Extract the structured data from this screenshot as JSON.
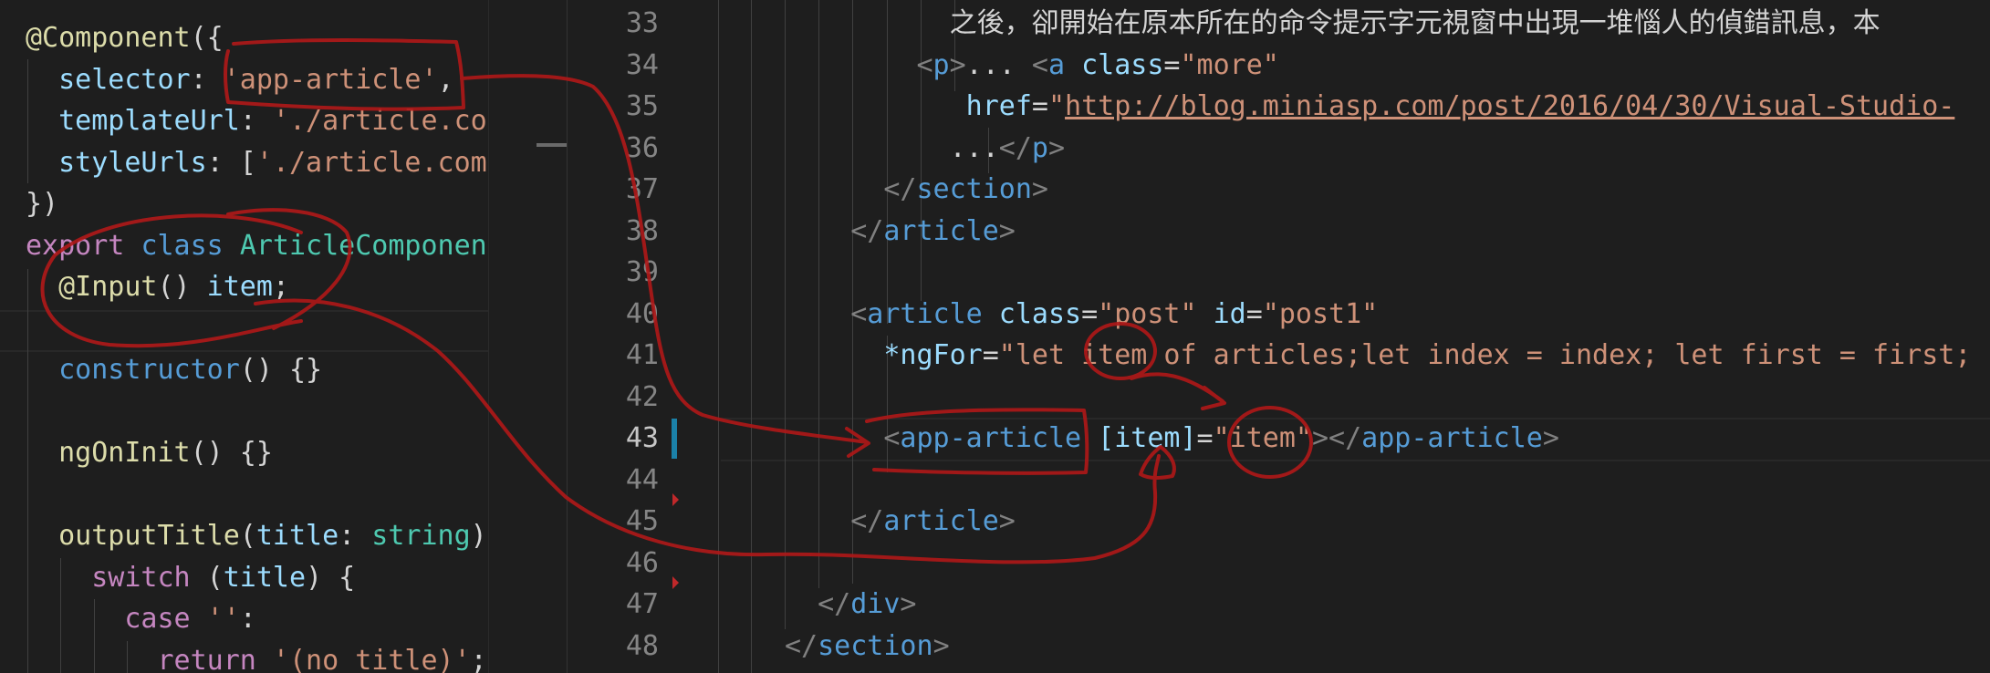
{
  "left_editor": {
    "lines": [
      {
        "indent": 0,
        "tokens": [
          {
            "t": "@Component",
            "c": "fn"
          },
          {
            "t": "({",
            "c": "txt"
          }
        ]
      },
      {
        "indent": 2,
        "tokens": [
          {
            "t": "selector",
            "c": "attr"
          },
          {
            "t": ": ",
            "c": "txt"
          },
          {
            "t": "'app-article'",
            "c": "str"
          },
          {
            "t": ",",
            "c": "txt"
          }
        ]
      },
      {
        "indent": 2,
        "tokens": [
          {
            "t": "templateUrl",
            "c": "attr"
          },
          {
            "t": ": ",
            "c": "txt"
          },
          {
            "t": "'./article.co",
            "c": "str"
          }
        ]
      },
      {
        "indent": 2,
        "tokens": [
          {
            "t": "styleUrls",
            "c": "attr"
          },
          {
            "t": ": [",
            "c": "txt"
          },
          {
            "t": "'./article.com",
            "c": "str"
          }
        ]
      },
      {
        "indent": 0,
        "tokens": [
          {
            "t": "})",
            "c": "txt"
          }
        ]
      },
      {
        "indent": 0,
        "tokens": [
          {
            "t": "export",
            "c": "kw"
          },
          {
            "t": " ",
            "c": "txt"
          },
          {
            "t": "class",
            "c": "key"
          },
          {
            "t": " ",
            "c": "txt"
          },
          {
            "t": "ArticleComponen",
            "c": "cls"
          }
        ]
      },
      {
        "indent": 2,
        "tokens": [
          {
            "t": "@Input",
            "c": "fn"
          },
          {
            "t": "() ",
            "c": "txt"
          },
          {
            "t": "item",
            "c": "attr"
          },
          {
            "t": ";",
            "c": "txt"
          }
        ]
      },
      {
        "indent": 0,
        "tokens": []
      },
      {
        "indent": 2,
        "tokens": [
          {
            "t": "constructor",
            "c": "key"
          },
          {
            "t": "() {}",
            "c": "txt"
          }
        ]
      },
      {
        "indent": 0,
        "tokens": []
      },
      {
        "indent": 2,
        "tokens": [
          {
            "t": "ngOnInit",
            "c": "fn"
          },
          {
            "t": "() {}",
            "c": "txt"
          }
        ]
      },
      {
        "indent": 0,
        "tokens": []
      },
      {
        "indent": 2,
        "tokens": [
          {
            "t": "outputTitle",
            "c": "fn"
          },
          {
            "t": "(",
            "c": "txt"
          },
          {
            "t": "title",
            "c": "attr"
          },
          {
            "t": ": ",
            "c": "txt"
          },
          {
            "t": "string",
            "c": "cls"
          },
          {
            "t": ")",
            "c": "txt"
          }
        ]
      },
      {
        "indent": 4,
        "tokens": [
          {
            "t": "switch",
            "c": "kw"
          },
          {
            "t": " (",
            "c": "txt"
          },
          {
            "t": "title",
            "c": "attr"
          },
          {
            "t": ") {",
            "c": "txt"
          }
        ]
      },
      {
        "indent": 6,
        "tokens": [
          {
            "t": "case",
            "c": "kw"
          },
          {
            "t": " ",
            "c": "txt"
          },
          {
            "t": "''",
            "c": "str"
          },
          {
            "t": ":",
            "c": "txt"
          }
        ]
      },
      {
        "indent": 8,
        "tokens": [
          {
            "t": "return",
            "c": "kw"
          },
          {
            "t": " ",
            "c": "txt"
          },
          {
            "t": "'(no title)'",
            "c": "str"
          },
          {
            "t": ";",
            "c": "txt"
          }
        ]
      }
    ]
  },
  "right_editor": {
    "current_line": 43,
    "lines": [
      {
        "num": "33",
        "indent": 10,
        "tokens": [
          {
            "t": "之後，卻開始在原本所在的命令提示字元視窗中出現一堆惱人的偵錯訊息，本",
            "c": "txt"
          }
        ]
      },
      {
        "num": "34",
        "indent": 8,
        "tokens": [
          {
            "t": "<",
            "c": "tag"
          },
          {
            "t": "p",
            "c": "tn"
          },
          {
            "t": ">",
            "c": "tag"
          },
          {
            "t": "... ",
            "c": "txt"
          },
          {
            "t": "<",
            "c": "tag"
          },
          {
            "t": "a",
            "c": "tn"
          },
          {
            "t": " ",
            "c": "txt"
          },
          {
            "t": "class",
            "c": "attr"
          },
          {
            "t": "=",
            "c": "txt"
          },
          {
            "t": "\"more\"",
            "c": "str"
          }
        ]
      },
      {
        "num": "35",
        "indent": 11,
        "tokens": [
          {
            "t": "href",
            "c": "attr"
          },
          {
            "t": "=",
            "c": "txt"
          },
          {
            "t": "\"",
            "c": "str"
          },
          {
            "t": "http://blog.miniasp.com/post/2016/04/30/Visual-Studio-",
            "c": "link"
          }
        ]
      },
      {
        "num": "36",
        "indent": 10,
        "tokens": [
          {
            "t": "...",
            "c": "txt"
          },
          {
            "t": "</",
            "c": "tag"
          },
          {
            "t": "p",
            "c": "tn"
          },
          {
            "t": ">",
            "c": "tag"
          }
        ]
      },
      {
        "num": "37",
        "indent": 6,
        "tokens": [
          {
            "t": "</",
            "c": "tag"
          },
          {
            "t": "section",
            "c": "tn"
          },
          {
            "t": ">",
            "c": "tag"
          }
        ]
      },
      {
        "num": "38",
        "indent": 4,
        "tokens": [
          {
            "t": "</",
            "c": "tag"
          },
          {
            "t": "article",
            "c": "tn"
          },
          {
            "t": ">",
            "c": "tag"
          }
        ]
      },
      {
        "num": "39",
        "indent": 0,
        "tokens": []
      },
      {
        "num": "40",
        "indent": 4,
        "tokens": [
          {
            "t": "<",
            "c": "tag"
          },
          {
            "t": "article",
            "c": "tn"
          },
          {
            "t": " ",
            "c": "txt"
          },
          {
            "t": "class",
            "c": "attr"
          },
          {
            "t": "=",
            "c": "txt"
          },
          {
            "t": "\"post\"",
            "c": "str"
          },
          {
            "t": " ",
            "c": "txt"
          },
          {
            "t": "id",
            "c": "attr"
          },
          {
            "t": "=",
            "c": "txt"
          },
          {
            "t": "\"post1\"",
            "c": "str"
          }
        ]
      },
      {
        "num": "41",
        "indent": 6,
        "tokens": [
          {
            "t": "*ngFor",
            "c": "attr"
          },
          {
            "t": "=",
            "c": "txt"
          },
          {
            "t": "\"let item of articles;let index = index; let first = first;",
            "c": "str"
          }
        ]
      },
      {
        "num": "42",
        "indent": 0,
        "tokens": []
      },
      {
        "num": "43",
        "indent": 6,
        "tokens": [
          {
            "t": "<",
            "c": "tag"
          },
          {
            "t": "app-article",
            "c": "tn"
          },
          {
            "t": " ",
            "c": "txt"
          },
          {
            "t": "[item]",
            "c": "attr"
          },
          {
            "t": "=",
            "c": "txt"
          },
          {
            "t": "\"item\"",
            "c": "str"
          },
          {
            "t": ">",
            "c": "tag"
          },
          {
            "t": "</",
            "c": "tag"
          },
          {
            "t": "app-article",
            "c": "tn"
          },
          {
            "t": ">",
            "c": "tag"
          }
        ]
      },
      {
        "num": "44",
        "indent": 0,
        "tokens": []
      },
      {
        "num": "45",
        "indent": 4,
        "tokens": [
          {
            "t": "</",
            "c": "tag"
          },
          {
            "t": "article",
            "c": "tn"
          },
          {
            "t": ">",
            "c": "tag"
          }
        ]
      },
      {
        "num": "46",
        "indent": 0,
        "tokens": []
      },
      {
        "num": "47",
        "indent": 2,
        "tokens": [
          {
            "t": "</",
            "c": "tag"
          },
          {
            "t": "div",
            "c": "tn"
          },
          {
            "t": ">",
            "c": "tag"
          }
        ]
      },
      {
        "num": "48",
        "indent": 0,
        "tokens": [
          {
            "t": "</",
            "c": "tag"
          },
          {
            "t": "section",
            "c": "tn"
          },
          {
            "t": ">",
            "c": "tag"
          }
        ]
      }
    ]
  },
  "colors": {
    "background": "#1e1e1e",
    "annotation_ink": "#b01818",
    "modified_bar": "#1b81a8",
    "deleted_marker": "#c0282a"
  }
}
